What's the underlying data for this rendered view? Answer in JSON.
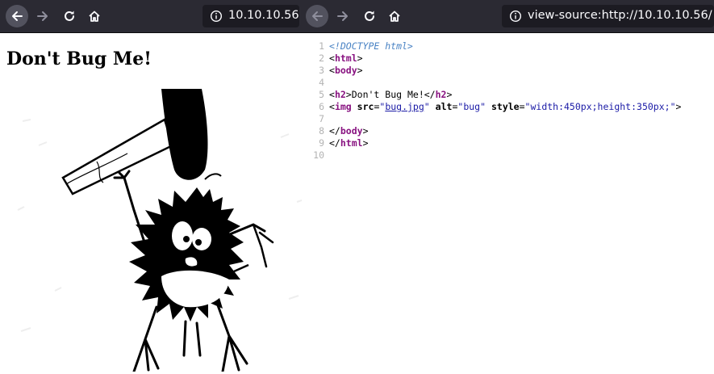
{
  "left_window": {
    "address": "10.10.10.56",
    "page": {
      "heading": "Don't Bug Me!",
      "image_alt": "bug"
    }
  },
  "right_window": {
    "address": "view-source:http://10.10.10.56/",
    "source": {
      "line_numbers": [
        "1",
        "2",
        "3",
        "4",
        "5",
        "6",
        "7",
        "8",
        "9",
        "10"
      ],
      "doctype": "<!DOCTYPE html>",
      "lt": "<",
      "gt": ">",
      "lt_slash": "</",
      "tag_html": "html",
      "tag_body": "body",
      "tag_h2": "h2",
      "h2_text": "Don't Bug Me!",
      "tag_img": "img",
      "attr_src": "src",
      "attr_alt": "alt",
      "attr_style": "style",
      "eq": "=",
      "quote": "\"",
      "val_src": "bug.jpg",
      "val_alt": "bug",
      "val_style": "width:450px;height:350px;"
    }
  },
  "colors": {
    "toolbar": "#2b2a33",
    "urlbar": "#1c1b22",
    "tag": "#881280",
    "attr_value": "#1a1aa6",
    "doctype": "#4a83c4"
  },
  "icons": [
    "back-arrow-icon",
    "forward-arrow-icon",
    "reload-icon",
    "home-icon",
    "info-icon"
  ]
}
